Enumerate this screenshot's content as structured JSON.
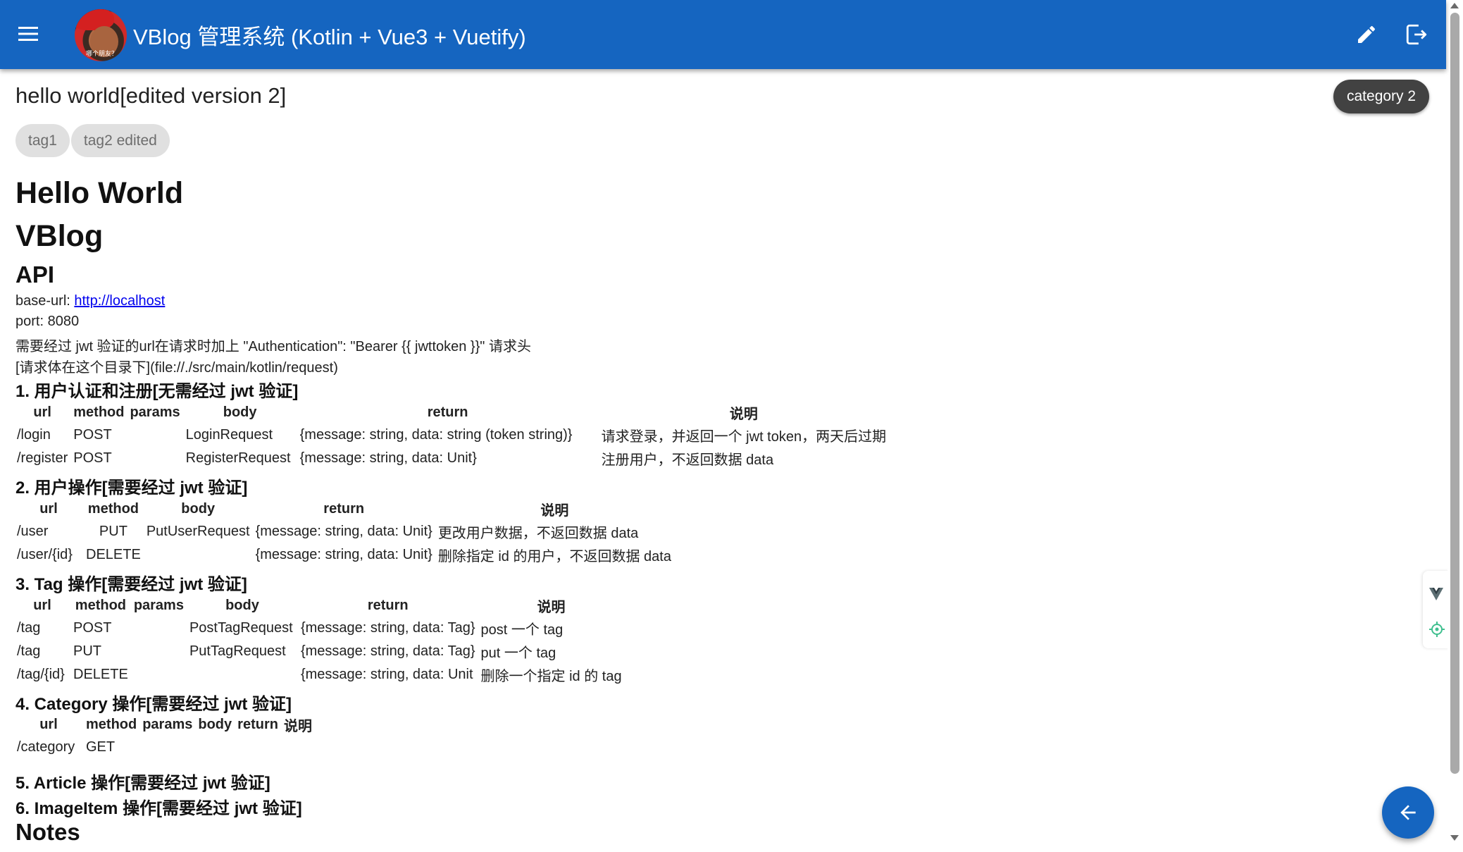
{
  "appbar": {
    "title": "VBlog 管理系统 (Kotlin + Vue3 + Vuetify)",
    "avatar_caption": "哪个朋友？",
    "icons": {
      "menu": "menu-icon",
      "edit": "pencil-icon",
      "logout": "logout-icon"
    }
  },
  "post": {
    "title": "hello world[edited version 2]",
    "category": "category 2",
    "tags": [
      "tag1",
      "tag2 edited"
    ]
  },
  "content": {
    "h1_1": "Hello World",
    "h1_2": "VBlog",
    "h2_api": "API",
    "base_url_label": "base-url: ",
    "base_url_link": "http://localhost",
    "port": "port: 8080",
    "jwt_note": "需要经过 jwt 验证的url在请求时加上 \"Authentication\": \"Bearer {{ jwttoken }}\" 请求头",
    "request_dir": "[请求体在这个目录下](file://./src/main/kotlin/request)",
    "s1": {
      "heading": "1. 用户认证和注册[无需经过 jwt 验证]",
      "headers": [
        "url",
        "method",
        "params",
        "body",
        "return",
        "说明"
      ],
      "rows": [
        [
          "/login",
          "POST",
          "",
          "LoginRequest",
          "{message: string, data: string (token string)}",
          "请求登录，并返回一个 jwt token，两天后过期"
        ],
        [
          "/register",
          "POST",
          "",
          "RegisterRequest",
          "{message: string, data: Unit}",
          "注册用户，不返回数据 data"
        ]
      ]
    },
    "s2": {
      "heading": "2. 用户操作[需要经过 jwt 验证]",
      "headers": [
        "url",
        "method",
        "body",
        "return",
        "说明"
      ],
      "rows": [
        [
          "/user",
          "PUT",
          "PutUserRequest",
          "{message: string, data: Unit}",
          "更改用户数据，不返回数据 data"
        ],
        [
          "/user/{id}",
          "DELETE",
          "",
          "{message: string, data: Unit}",
          "删除指定 id 的用户，不返回数据 data"
        ]
      ]
    },
    "s3": {
      "heading": "3. Tag 操作[需要经过 jwt 验证]",
      "headers": [
        "url",
        "method",
        "params",
        "body",
        "return",
        "说明"
      ],
      "rows": [
        [
          "/tag",
          "POST",
          "",
          "PostTagRequest",
          "{message: string, data: Tag}",
          "post 一个 tag"
        ],
        [
          "/tag",
          "PUT",
          "",
          "PutTagRequest",
          "{message: string, data: Tag}",
          "put 一个 tag"
        ],
        [
          "/tag/{id}",
          "DELETE",
          "",
          "",
          "{message: string, data: Unit",
          "删除一个指定 id 的 tag"
        ]
      ]
    },
    "s4": {
      "heading": "4. Category 操作[需要经过 jwt 验证]",
      "headers": [
        "url",
        "method",
        "params",
        "body",
        "return",
        "说明"
      ],
      "rows": [
        [
          "/category",
          "GET",
          "",
          "",
          "",
          ""
        ]
      ]
    },
    "s5_heading": "5. Article 操作[需要经过 jwt 验证]",
    "s6_heading": "6. ImageItem 操作[需要经过 jwt 验证]",
    "notes_heading": "Notes"
  },
  "fab": {
    "icon": "arrow-left-icon"
  },
  "devtools": {
    "icons": [
      "vue-devtools-icon",
      "target-icon"
    ]
  }
}
